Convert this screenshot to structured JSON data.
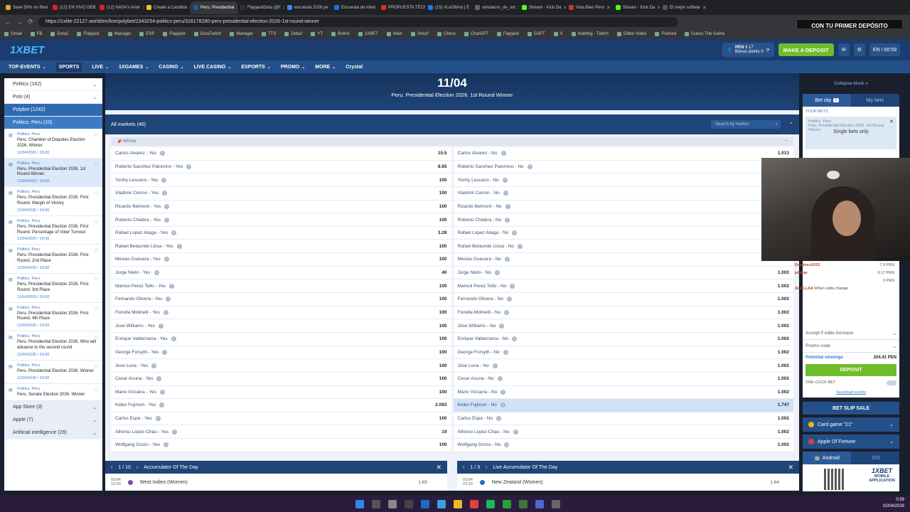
{
  "browser": {
    "tabs": [
      {
        "label": "Save 50% on Resi",
        "color": "#e8a530"
      },
      {
        "label": "(12) EN VIVO DEB",
        "color": "#e02020"
      },
      {
        "label": "(12) NASA's Arter",
        "color": "#e02020"
      },
      {
        "label": "Create a Candida",
        "color": "#f0c020"
      },
      {
        "label": "Peru. Presidential",
        "color": "#1a5aa8",
        "active": true
      },
      {
        "label": "FlapjackDota (@f",
        "color": "#333333"
      },
      {
        "label": "encuesta 2026 pe",
        "color": "#4285f4"
      },
      {
        "label": "Encuesta de Inten",
        "color": "#1a73e8"
      },
      {
        "label": "PROPUESTA TÉCN",
        "color": "#d93025"
      },
      {
        "label": "(15) #LoÚltimo | E",
        "color": "#1877f2"
      },
      {
        "label": "simulacro_de_vot",
        "color": "#666666"
      },
      {
        "label": "Stream - Kick Da",
        "color": "#53fc18"
      },
      {
        "label": "Vota Bien Perú",
        "color": "#c0392b"
      },
      {
        "label": "Stream - Kick Da",
        "color": "#53fc18"
      },
      {
        "label": "El mejor softwar",
        "color": "#555555"
      }
    ],
    "url": "https://1xlite-22127.world/en/line/polybet/2343254-politics-peru/316178280-peru-presidential-election-2026-1st-round-winner",
    "bookmarks": [
      "Gmail",
      "FB",
      "Dota2",
      "Flapjack",
      "Manager",
      "ESP",
      "Flapjack",
      "DotaTwitch",
      "Manager",
      "TTS",
      "Dota2",
      "YT",
      "Botnix",
      "1XBET",
      "Main",
      "Smurf",
      "Chess",
      "ChatGPT",
      "Flapjack",
      "D2PT",
      "X",
      "malding - Twitch",
      "Editor Video",
      "Framed",
      "Guess The Game"
    ],
    "overlay_banner": "CON TU PRIMER DEPÓSITO"
  },
  "header": {
    "logo_main": "1X",
    "logo_accent": "BET",
    "currency": "PEN",
    "balance": "9.17",
    "bonus_label": "Bonus points",
    "bonus_value": "0",
    "deposit_button": "MAKE A DEPOSIT",
    "lang_time": "EN / 00:59"
  },
  "nav": [
    "TOP-EVENTS",
    "SPORTS",
    "LIVE",
    "1XGAMES",
    "CASINO",
    "LIVE CASINO",
    "ESPORTS",
    "PROMO",
    "MORE",
    "Crystal"
  ],
  "sidebar": {
    "rows_top": [
      {
        "label": "Politics (162)"
      },
      {
        "label": "Polo (4)"
      },
      {
        "label": "Polybet (1242)",
        "state": "sel"
      },
      {
        "label": "Politics. Peru (10)",
        "state": "sel2"
      }
    ],
    "events": [
      {
        "cat": "Politics. Peru",
        "name": "Peru. Chamber of Deputies Election 2026. Winner",
        "time": "11/04/2026 / 19:00"
      },
      {
        "cat": "Politics. Peru",
        "name": "Peru. Presidential Election 2026. 1st Round Winner",
        "time": "11/04/2026 / 19:00",
        "current": true
      },
      {
        "cat": "Politics. Peru",
        "name": "Peru. Presidential Election 2026. First Round. Margin of Victory",
        "time": "11/04/2026 / 19:00"
      },
      {
        "cat": "Politics. Peru",
        "name": "Peru. Presidential Election 2026. First Round. Percentage of Voter Turnout",
        "time": "11/04/2026 / 19:00"
      },
      {
        "cat": "Politics. Peru",
        "name": "Peru. Presidential Election 2026. First Round. 2nd Place",
        "time": "11/04/2026 / 19:00"
      },
      {
        "cat": "Politics. Peru",
        "name": "Peru. Presidential Election 2026. First Round. 3rd Place",
        "time": "11/04/2026 / 19:00"
      },
      {
        "cat": "Politics. Peru",
        "name": "Peru. Presidential Election 2026. First Round. 4th Place",
        "time": "11/04/2026 / 19:00"
      },
      {
        "cat": "Politics. Peru",
        "name": "Peru. Presidential Election 2026. Who will advance to the second round",
        "time": "11/04/2026 / 19:00"
      },
      {
        "cat": "Politics. Peru",
        "name": "Peru. Presidential Election 2026. Winner",
        "time": "11/04/2026 / 19:00"
      },
      {
        "cat": "Politics. Peru",
        "name": "Peru. Senate Election 2026. Winner",
        "time": ""
      }
    ],
    "rows_bottom": [
      {
        "label": "App Store (3)"
      },
      {
        "label": "Apple (7)"
      },
      {
        "label": "Artificial intelligence (29)"
      }
    ]
  },
  "main": {
    "date": "11/04",
    "title": "Peru. Presidential Election 2026. 1st Round Winner",
    "all_markets": "All markets (46)",
    "search_placeholder": "Search by market",
    "section": "Winner",
    "odds": [
      [
        "Carlos Alvarez - Yes",
        "15.5",
        "Carlos Alvarez - No",
        "1.013"
      ],
      [
        "Roberto Sanchez Palomino - Yes",
        "8.65",
        "Roberto Sanchez Palomino - No",
        ""
      ],
      [
        "Yonhy Lescano - Yes",
        "100",
        "Yonhy Lescano - No",
        ""
      ],
      [
        "Vladimir Cerron - Yes",
        "100",
        "Vladimir Cerron - No",
        ""
      ],
      [
        "Ricardo Belmont - Yes",
        "100",
        "Ricardo Belmont - No",
        ""
      ],
      [
        "Roberto Chiabra - Yes",
        "100",
        "Roberto Chiabra - No",
        ""
      ],
      [
        "Rafael Lopez Aliaga - Yes",
        "3.28",
        "Rafael Lopez Aliaga - No",
        ""
      ],
      [
        "Rafael Belaunde Llosa - Yes",
        "100",
        "Rafael Belaunde Llosa - No",
        ""
      ],
      [
        "Mesias Guevara - Yes",
        "100",
        "Mesias Guevara - No",
        ""
      ],
      [
        "Jorge Nieto - Yes",
        "40",
        "Jorge Nieto - No",
        "1.002"
      ],
      [
        "Marisol Perez Tello - Yes",
        "100",
        "Marisol Perez Tello - No",
        "1.002"
      ],
      [
        "Fernando Olivera - Yes",
        "100",
        "Fernando Olivera - No",
        "1.002"
      ],
      [
        "Fiorella Molinelli - Yes",
        "100",
        "Fiorella Molinelli - No",
        "1.002"
      ],
      [
        "Jose Williams - Yes",
        "100",
        "Jose Williams - No",
        "1.002"
      ],
      [
        "Enrique Valderrama - Yes",
        "100",
        "Enrique Valderrama - No",
        "1.002"
      ],
      [
        "George Forsyth - Yes",
        "100",
        "George Forsyth - No",
        "1.002"
      ],
      [
        "Jose Luna - Yes",
        "100",
        "Jose Luna - No",
        "1.002"
      ],
      [
        "Cesar Acuna - Yes",
        "100",
        "Cesar Acuna - No",
        "1.002"
      ],
      [
        "Mario Vizcarra - Yes",
        "100",
        "Mario Vizcarra - No",
        "1.002"
      ],
      [
        "Keiko Fujimori - Yes",
        "2.093",
        "Keiko Fujimori - No",
        "1.747"
      ],
      [
        "Carlos Espa - Yes",
        "100",
        "Carlos Espa - No",
        "1.002"
      ],
      [
        "Alfonso Lopez-Chau - Yes",
        "19",
        "Alfonso Lopez-Chau - No",
        "1.002"
      ],
      [
        "Wolfgang Grozo - Yes",
        "100",
        "Wolfgang Grozo - No",
        "1.002"
      ]
    ],
    "highlighted_row": 19,
    "acc_left": {
      "pager": "1 / 10",
      "title": "Accumulator Of The Day",
      "date": "02/04",
      "time": "13:00",
      "team": "West Indies (Women)",
      "price": "1.65"
    },
    "acc_right": {
      "pager": "1 / 3",
      "title": "Live Accumulator Of The Day",
      "date": "01/04",
      "time": "23:30",
      "team": "New Zealand (Women)",
      "price": "1.64"
    }
  },
  "right": {
    "collapse": "Collapse block »",
    "tab_slip": "Bet slip",
    "slip_count": "2",
    "tab_mybets": "My bets",
    "your_bets": "YOUR BETS",
    "card_line1": "Politics. Peru",
    "card_line2": "Peru. Presidential Election 2026. 1st Round Winner",
    "single_only": "Single bets only",
    "chat": [
      {
        "user": "Deadeeu1515",
        "msg": "",
        "amt": "7.9 PEN"
      },
      {
        "user": "pdsfae",
        "msg": "",
        "amt": "9.17 PEN"
      },
      {
        "user": "",
        "msg": "",
        "amt": "0 PEN"
      },
      {
        "user": "ALALLAA",
        "msg": "When odds change",
        "amt": ""
      },
      {
        "user": "",
        "msg": "Accept if odds increase",
        "amt": ""
      }
    ],
    "promo_code": "Promo code",
    "potential_label": "Potential winnings",
    "potential_value": "204.41 PEN",
    "deposit": "DEPOSIT",
    "one_click": "ONE-CLICK BET",
    "save_load": "Save/load events",
    "sale": "BET SLIP SALE",
    "game1": "Card game \"21\"",
    "game2": "Apple Of Fortune",
    "platform_android": "Android",
    "platform_ios": "iOS",
    "app_logo": "1XBET",
    "app_text1": "MOBILE",
    "app_text2": "APPLICATION"
  },
  "taskbar": {
    "time": "0:59",
    "date": "02/04/2026"
  }
}
